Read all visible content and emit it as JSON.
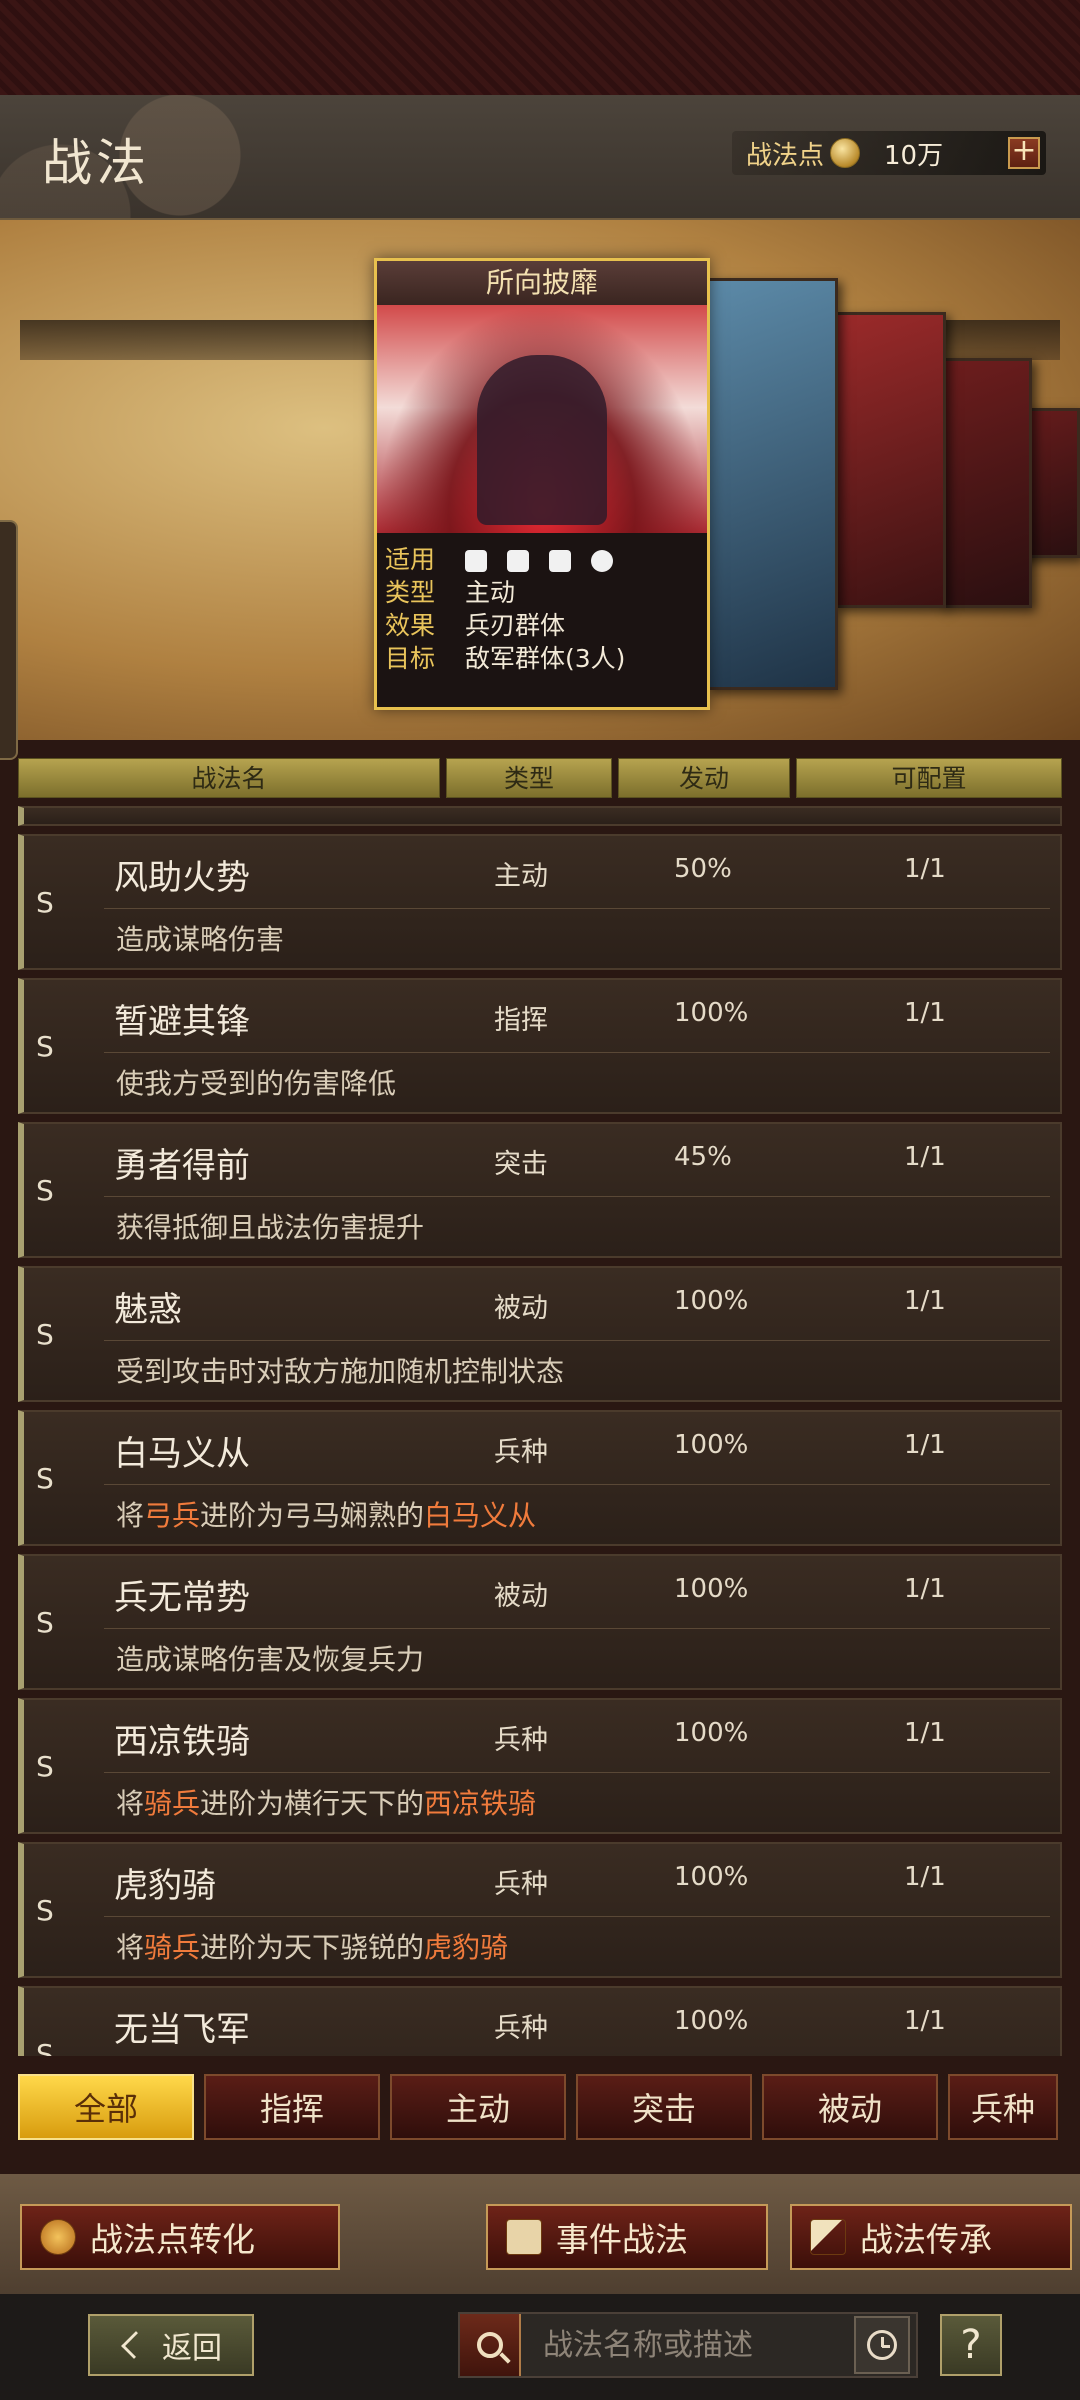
{
  "header": {
    "title": "战法",
    "points_label": "战法点",
    "points_value": "10万",
    "plus": "+"
  },
  "featured_card": {
    "name": "所向披靡",
    "rows": [
      {
        "key": "适用",
        "value": ""
      },
      {
        "key": "类型",
        "value": "主动"
      },
      {
        "key": "效果",
        "value": "兵刃群体"
      },
      {
        "key": "目标",
        "value": "敌军群体(3人)"
      }
    ]
  },
  "table": {
    "headers": [
      "战法名",
      "类型",
      "发动",
      "可配置"
    ]
  },
  "rows": [
    {
      "grade": "S",
      "name": "风助火势",
      "type": "主动",
      "rate": "50%",
      "config": "1/1",
      "desc": [
        {
          "t": "造成谋略伤害",
          "hl": false
        }
      ]
    },
    {
      "grade": "S",
      "name": "暂避其锋",
      "type": "指挥",
      "rate": "100%",
      "config": "1/1",
      "desc": [
        {
          "t": "使我方受到的伤害降低",
          "hl": false
        }
      ]
    },
    {
      "grade": "S",
      "name": "勇者得前",
      "type": "突击",
      "rate": "45%",
      "config": "1/1",
      "desc": [
        {
          "t": "获得抵御且战法伤害提升",
          "hl": false
        }
      ]
    },
    {
      "grade": "S",
      "name": "魅惑",
      "type": "被动",
      "rate": "100%",
      "config": "1/1",
      "desc": [
        {
          "t": "受到攻击时对敌方施加随机控制状态",
          "hl": false
        }
      ]
    },
    {
      "grade": "S",
      "name": "白马义从",
      "type": "兵种",
      "rate": "100%",
      "config": "1/1",
      "desc": [
        {
          "t": "将",
          "hl": false
        },
        {
          "t": "弓兵",
          "hl": true
        },
        {
          "t": "进阶为弓马娴熟的",
          "hl": false
        },
        {
          "t": "白马义从",
          "hl": true
        }
      ]
    },
    {
      "grade": "S",
      "name": "兵无常势",
      "type": "被动",
      "rate": "100%",
      "config": "1/1",
      "desc": [
        {
          "t": "造成谋略伤害及恢复兵力",
          "hl": false
        }
      ]
    },
    {
      "grade": "S",
      "name": "西凉铁骑",
      "type": "兵种",
      "rate": "100%",
      "config": "1/1",
      "desc": [
        {
          "t": "将",
          "hl": false
        },
        {
          "t": "骑兵",
          "hl": true
        },
        {
          "t": "进阶为横行天下的",
          "hl": false
        },
        {
          "t": "西凉铁骑",
          "hl": true
        }
      ]
    },
    {
      "grade": "S",
      "name": "虎豹骑",
      "type": "兵种",
      "rate": "100%",
      "config": "1/1",
      "desc": [
        {
          "t": "将",
          "hl": false
        },
        {
          "t": "骑兵",
          "hl": true
        },
        {
          "t": "进阶为天下骁锐的",
          "hl": false
        },
        {
          "t": "虎豹骑",
          "hl": true
        }
      ]
    },
    {
      "grade": "S",
      "name": "无当飞军",
      "type": "兵种",
      "rate": "100%",
      "config": "1/1",
      "desc": []
    }
  ],
  "tabs": [
    "全部",
    "指挥",
    "主动",
    "突击",
    "被动",
    "兵种"
  ],
  "actions": {
    "convert": "战法点转化",
    "event": "事件战法",
    "inherit": "战法传承"
  },
  "bottom": {
    "back": "返回",
    "search_placeholder": "战法名称或描述",
    "help": "?"
  },
  "colors": {
    "highlight": "#f07b3c",
    "active_tab": "#ffd84a"
  }
}
